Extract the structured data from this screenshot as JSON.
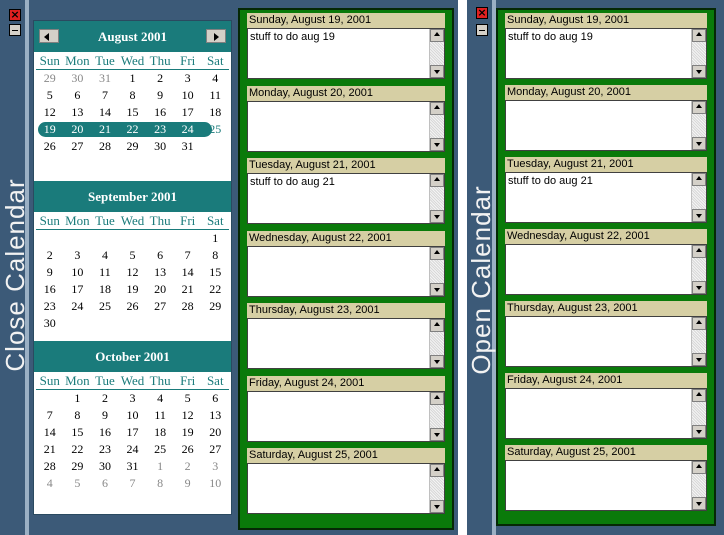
{
  "left_window": {
    "sidebar_label": "Close Calendar",
    "close_icon": "×",
    "calendar": {
      "months": [
        {
          "title": "August 2001",
          "dow": [
            "Sun",
            "Mon",
            "Tue",
            "Wed",
            "Thu",
            "Fri",
            "Sat"
          ],
          "weeks": [
            [
              "29",
              "30",
              "31",
              "1",
              "2",
              "3",
              "4"
            ],
            [
              "5",
              "6",
              "7",
              "8",
              "9",
              "10",
              "11"
            ],
            [
              "12",
              "13",
              "14",
              "15",
              "16",
              "17",
              "18"
            ],
            [
              "19",
              "20",
              "21",
              "22",
              "23",
              "24",
              "25"
            ],
            [
              "26",
              "27",
              "28",
              "29",
              "30",
              "31",
              ""
            ]
          ]
        },
        {
          "title": "September 2001",
          "dow": [
            "Sun",
            "Mon",
            "Tue",
            "Wed",
            "Thu",
            "Fri",
            "Sat"
          ],
          "weeks": [
            [
              "",
              "",
              "",
              "",
              "",
              "",
              "1"
            ],
            [
              "2",
              "3",
              "4",
              "5",
              "6",
              "7",
              "8"
            ],
            [
              "9",
              "10",
              "11",
              "12",
              "13",
              "14",
              "15"
            ],
            [
              "16",
              "17",
              "18",
              "19",
              "20",
              "21",
              "22"
            ],
            [
              "23",
              "24",
              "25",
              "26",
              "27",
              "28",
              "29"
            ],
            [
              "30",
              "",
              "",
              "",
              "",
              "",
              ""
            ]
          ]
        },
        {
          "title": "October 2001",
          "dow": [
            "Sun",
            "Mon",
            "Tue",
            "Wed",
            "Thu",
            "Fri",
            "Sat"
          ],
          "weeks": [
            [
              "",
              "1",
              "2",
              "3",
              "4",
              "5",
              "6"
            ],
            [
              "7",
              "8",
              "9",
              "10",
              "11",
              "12",
              "13"
            ],
            [
              "14",
              "15",
              "16",
              "17",
              "18",
              "19",
              "20"
            ],
            [
              "21",
              "22",
              "23",
              "24",
              "25",
              "26",
              "27"
            ],
            [
              "28",
              "29",
              "30",
              "31",
              "1",
              "2",
              "3"
            ],
            [
              "4",
              "5",
              "6",
              "7",
              "8",
              "9",
              "10"
            ]
          ]
        }
      ]
    }
  },
  "right_window": {
    "sidebar_label": "Open Calendar",
    "close_icon": "×"
  },
  "days": [
    {
      "header": "Sunday, August 19, 2001",
      "text": "stuff to do aug 19"
    },
    {
      "header": "Monday, August 20, 2001",
      "text": ""
    },
    {
      "header": "Tuesday, August 21, 2001",
      "text": "stuff to do aug 21"
    },
    {
      "header": "Wednesday, August 22, 2001",
      "text": ""
    },
    {
      "header": "Thursday, August 23, 2001",
      "text": ""
    },
    {
      "header": "Friday, August 24, 2001",
      "text": ""
    },
    {
      "header": "Saturday, August 25, 2001",
      "text": ""
    }
  ],
  "colors": {
    "panel_bg": "#3c5a78",
    "month_header": "#1a7b7b",
    "day_panel": "#0a7a0a",
    "day_header": "#d6cfa4",
    "highlight_ring": "#e01010"
  }
}
